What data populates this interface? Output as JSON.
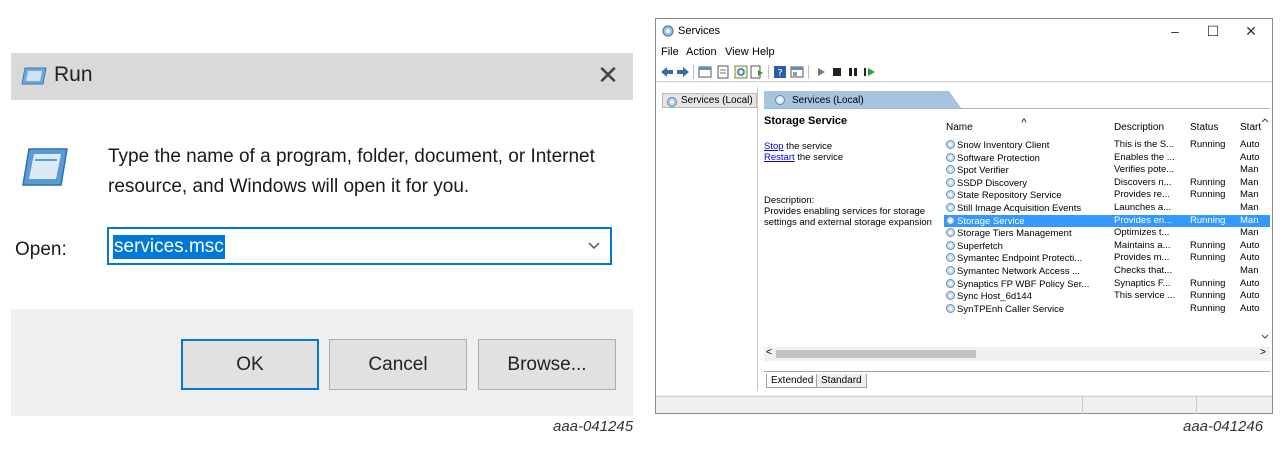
{
  "run_dialog": {
    "title": "Run",
    "description": "Type the name of a program, folder, document, or Internet resource, and Windows will open it for you.",
    "open_label": "Open:",
    "input_value": "services.msc",
    "buttons": {
      "ok": "OK",
      "cancel": "Cancel",
      "browse": "Browse..."
    },
    "figure_label": "aaa-041245"
  },
  "services_window": {
    "title": "Services",
    "window_buttons": {
      "minimize": "–",
      "maximize": "☐",
      "close": "✕"
    },
    "menu": [
      "File",
      "Action",
      "View",
      "Help"
    ],
    "tree_item": "Services (Local)",
    "content_header": "Services (Local)",
    "detail": {
      "service_name": "Storage Service",
      "stop_link": "Stop",
      "stop_rest": " the service",
      "restart_link": "Restart",
      "restart_rest": " the service",
      "description_label": "Description:",
      "description_text": "Provides enabling services for storage settings and external storage expansion"
    },
    "columns": {
      "name": "Name",
      "description": "Description",
      "status": "Status",
      "startup": "Start"
    },
    "rows": [
      {
        "name": "Snow Inventory Client",
        "description": "This is the S...",
        "status": "Running",
        "startup": "Auto"
      },
      {
        "name": "Software Protection",
        "description": "Enables the ...",
        "status": "",
        "startup": "Auto"
      },
      {
        "name": "Spot Verifier",
        "description": "Verifies pote...",
        "status": "",
        "startup": "Man"
      },
      {
        "name": "SSDP Discovery",
        "description": "Discovers n...",
        "status": "Running",
        "startup": "Man"
      },
      {
        "name": "State Repository Service",
        "description": "Provides re...",
        "status": "Running",
        "startup": "Man"
      },
      {
        "name": "Still Image Acquisition Events",
        "description": "Launches a...",
        "status": "",
        "startup": "Man"
      },
      {
        "name": "Storage Service",
        "description": "Provides en...",
        "status": "Running",
        "startup": "Man",
        "selected": true
      },
      {
        "name": "Storage Tiers Management",
        "description": "Optimizes t...",
        "status": "",
        "startup": "Man"
      },
      {
        "name": "Superfetch",
        "description": "Maintains a...",
        "status": "Running",
        "startup": "Auto"
      },
      {
        "name": "Symantec Endpoint Protecti...",
        "description": "Provides m...",
        "status": "Running",
        "startup": "Auto"
      },
      {
        "name": "Symantec Network Access ...",
        "description": "Checks that...",
        "status": "",
        "startup": "Man"
      },
      {
        "name": "Synaptics FP WBF Policy Ser...",
        "description": "Synaptics F...",
        "status": "Running",
        "startup": "Auto"
      },
      {
        "name": "Sync Host_6d144",
        "description": "This service ...",
        "status": "Running",
        "startup": "Auto"
      },
      {
        "name": "SynTPEnh Caller Service",
        "description": "",
        "status": "Running",
        "startup": "Auto"
      }
    ],
    "tabs": [
      "Extended",
      "Standard"
    ],
    "figure_label": "aaa-041246"
  },
  "colors": {
    "accent": "#0078d7",
    "selection": "#3399ff",
    "titlebar_gray": "#d9d9d9",
    "header_blue": "#a7c4de"
  }
}
